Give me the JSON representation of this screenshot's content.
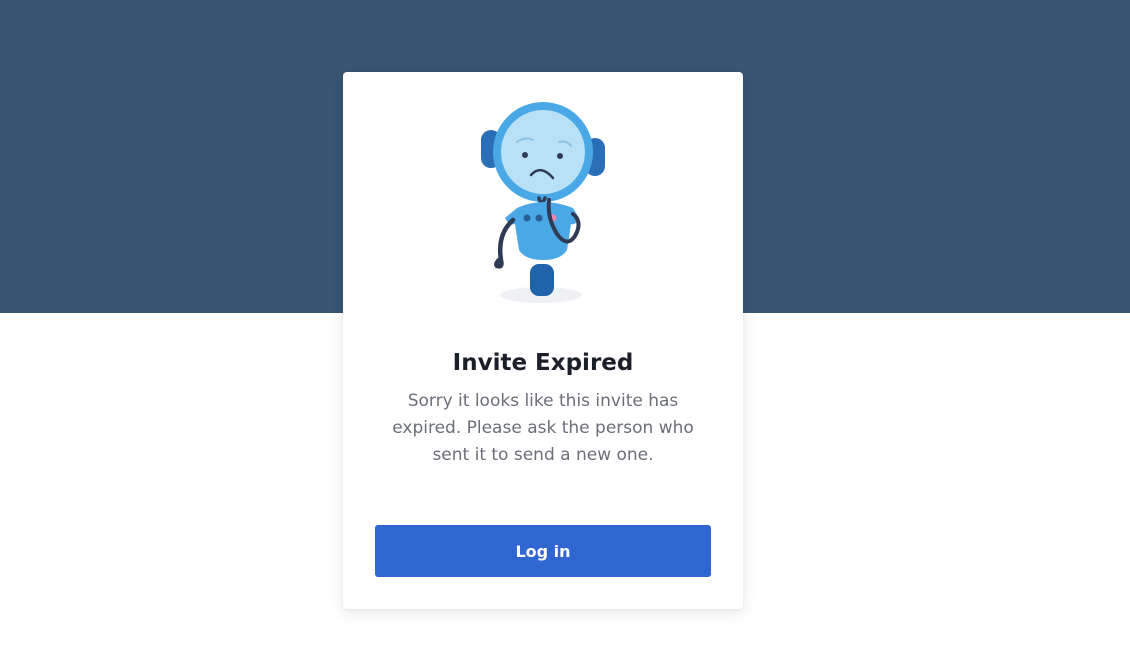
{
  "dialog": {
    "title": "Invite Expired",
    "message": "Sorry it looks like this invite has expired. Please ask the person who sent it to send a new one.",
    "button_label": "Log in"
  },
  "colors": {
    "header_band": "#365672",
    "page_background": "#ffffff",
    "button": "#3066d0",
    "title": "#1b1f2a",
    "message": "#6b6f78"
  },
  "illustration": {
    "icon": "sad-robot-illustration"
  }
}
